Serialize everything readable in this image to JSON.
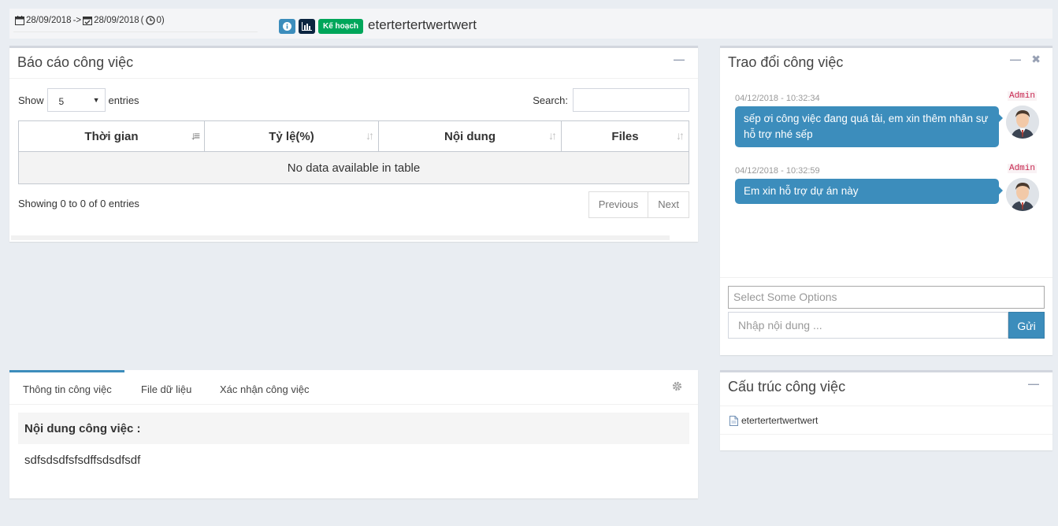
{
  "header": {
    "start_date": "28/09/2018",
    "arrow": "->",
    "end_date": "28/09/2018",
    "paren_open": "(",
    "duration": "0)",
    "plan_badge": "Kế hoạch",
    "task_title": "etertertertwertwert"
  },
  "report": {
    "title": "Báo cáo công việc",
    "show_label": "Show",
    "entries_value": "5",
    "entries_label": "entries",
    "search_label": "Search:",
    "columns": [
      "Thời gian",
      "Tỷ lệ(%)",
      "Nội dung",
      "Files"
    ],
    "empty_text": "No data available in table",
    "info_text": "Showing 0 to 0 of 0 entries",
    "prev_label": "Previous",
    "next_label": "Next"
  },
  "chat": {
    "title": "Trao đổi công việc",
    "messages": [
      {
        "time": "04/12/2018 - 10:32:34",
        "name": "Admin",
        "text": "sếp ơi công việc đang quá tải, em xin thêm nhân sự hỗ trợ nhé sếp"
      },
      {
        "time": "04/12/2018 - 10:32:59",
        "name": "Admin",
        "text": "Em xin hỗ trợ dự án này"
      }
    ],
    "select_placeholder": "Select Some Options",
    "input_placeholder": "Nhập nội dung ...",
    "send_label": "Gửi"
  },
  "tabs": {
    "items": [
      "Thông tin công việc",
      "File dữ liệu",
      "Xác nhận công việc"
    ],
    "content_heading": "Nội dung công việc :",
    "content_text": "sdfsdsdfsfsdffsdsdfsdf"
  },
  "structure": {
    "title": "Cấu trúc công việc",
    "item": "etertertertwertwert"
  },
  "colors": {
    "primary": "#3c8dbc",
    "success": "#00a65a",
    "dark": "#0b2540",
    "admin_label": "#c7254e"
  }
}
